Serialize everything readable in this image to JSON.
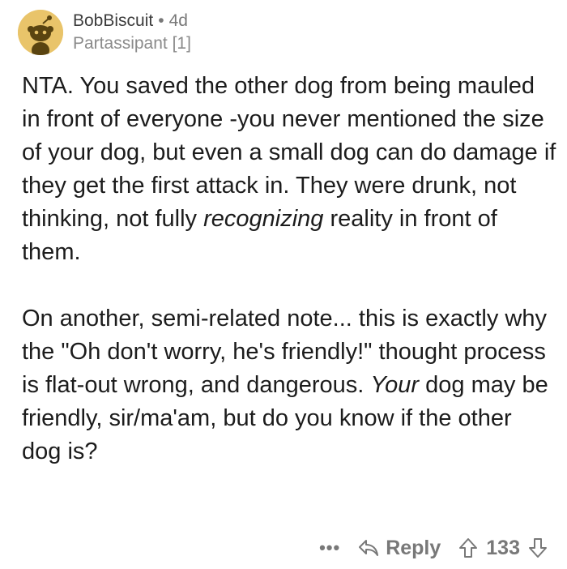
{
  "comment": {
    "username": "BobBiscuit",
    "separator": "•",
    "age": "4d",
    "flair": "Partassipant [1]",
    "paragraphs": [
      {
        "part1": "NTA. You saved the other dog from being mauled in front of everyone -you never mentioned the size of your dog, but even a small dog can do damage if they get the first attack in. They were drunk, not thinking, not fully ",
        "italic": "recognizing",
        "part2": " reality in front of them."
      },
      {
        "part1": "On another, semi-related note... this is exactly why the \"Oh don't worry, he's friendly!\" thought process is flat-out wrong, and dangerous. ",
        "italic": "Your",
        "part2": " dog may be friendly, sir/ma'am, but do you know if the other dog is?"
      }
    ]
  },
  "actions": {
    "more_label": "•••",
    "reply_label": "Reply",
    "score": "133"
  },
  "icons": {
    "avatar": "snoo-avatar-icon",
    "reply": "reply-arrow-icon",
    "upvote": "upvote-arrow-icon",
    "downvote": "downvote-arrow-icon"
  },
  "colors": {
    "avatar_bg": "#e9c46a",
    "meta_text": "#787878",
    "body_text": "#1c1c1c"
  }
}
